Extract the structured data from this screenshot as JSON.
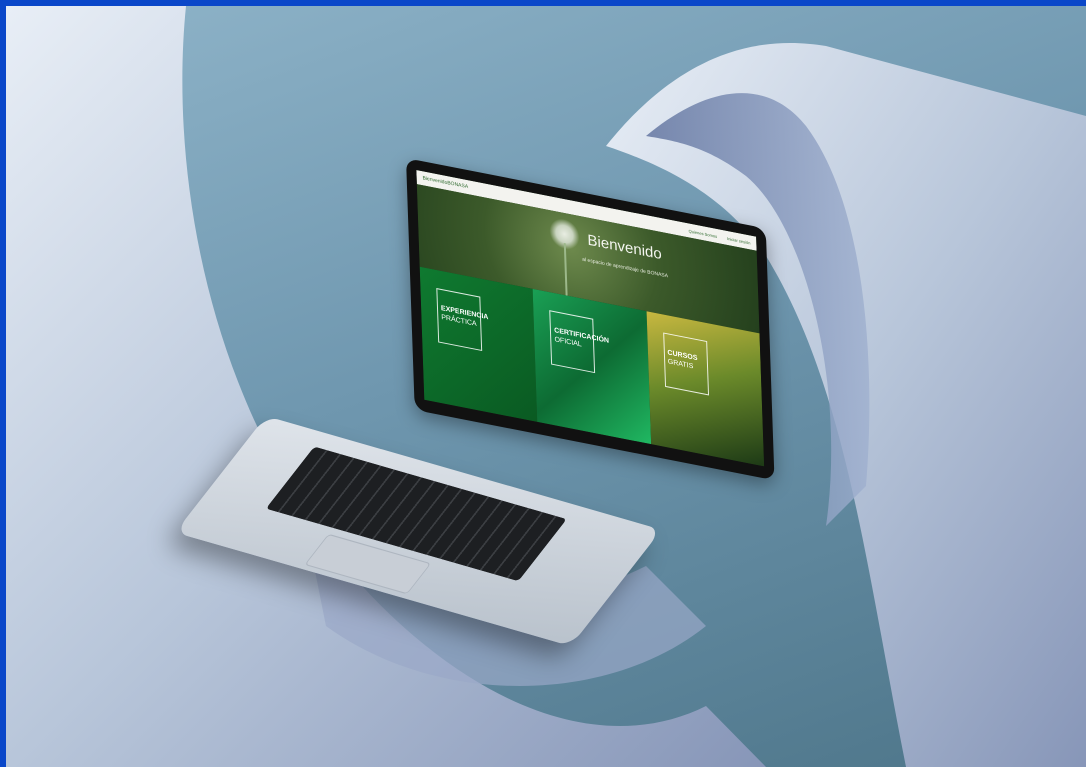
{
  "site": {
    "brand": "BienvenidoBONASA",
    "nav": [
      "Quienes Somos",
      "Iniciar sesión"
    ]
  },
  "hero": {
    "title": "Bienvenido",
    "subtitle": "al espacio de aprendizaje de BONASA"
  },
  "tiles": [
    {
      "title": "EXPERIENCIA",
      "subtitle": "PRÁCTICA"
    },
    {
      "title": "CERTIFICACIÓN",
      "subtitle": "OFICIAL"
    },
    {
      "title": "CURSOS",
      "subtitle": "GRATIS"
    }
  ],
  "colors": {
    "border": "#0a47c9",
    "ribbon": "#dfe7f2",
    "background": "#6f97af",
    "brand_green": "#0f7a30"
  }
}
